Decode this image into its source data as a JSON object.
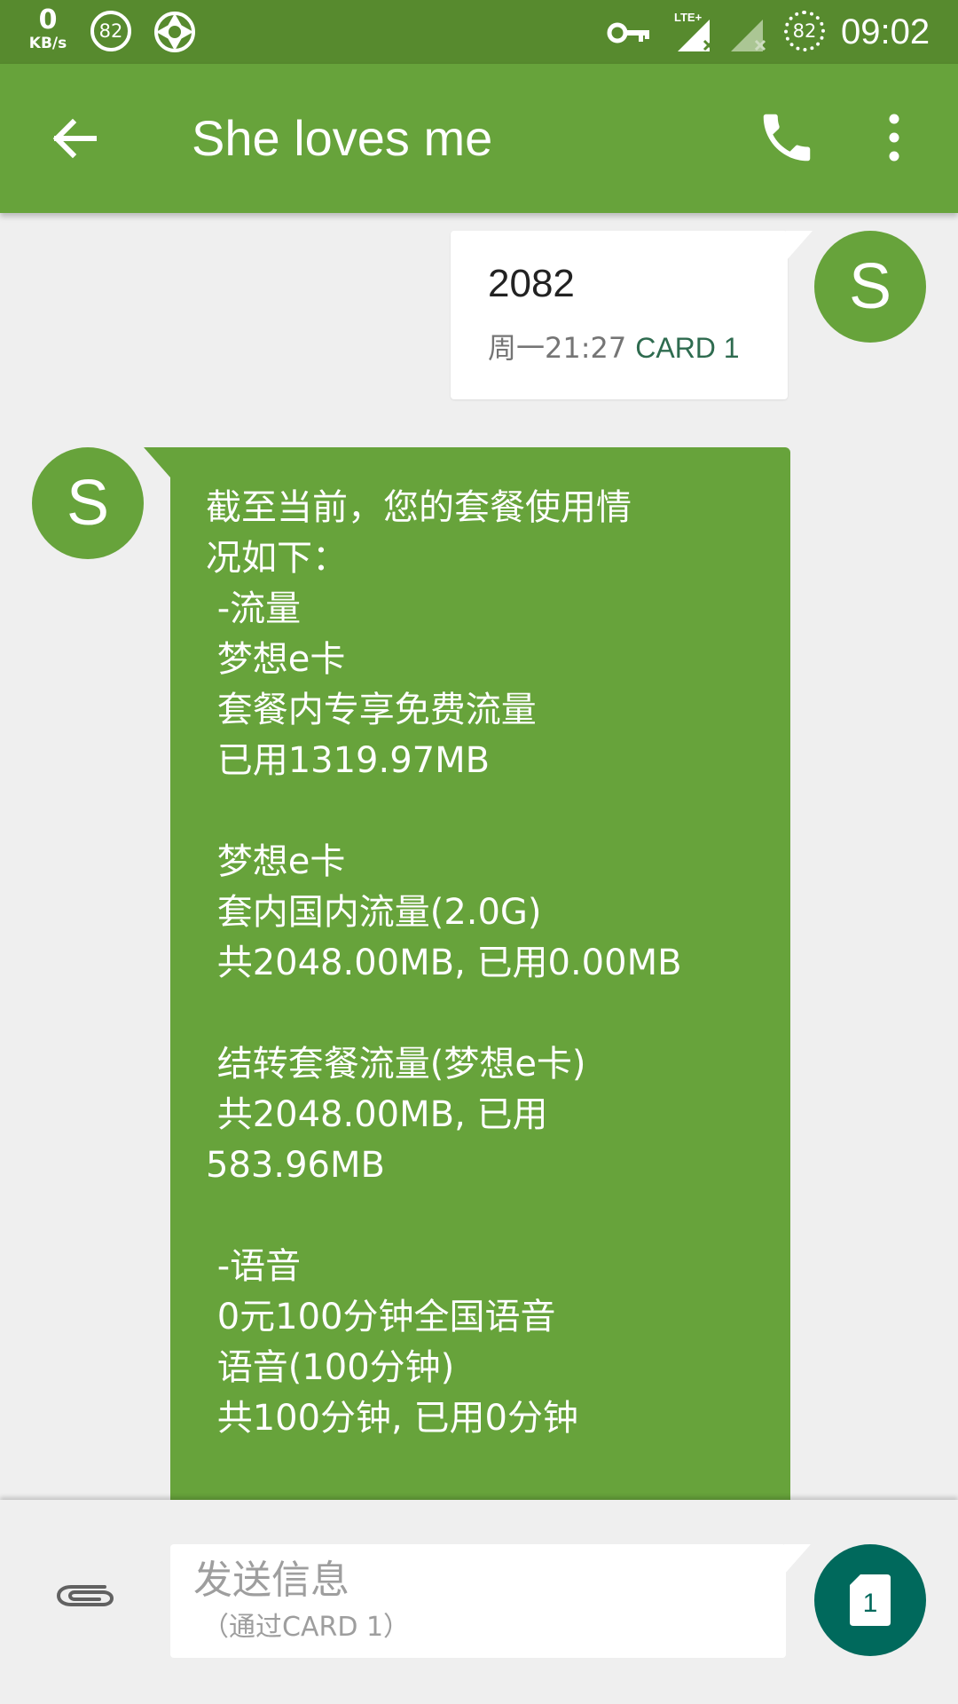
{
  "status_bar": {
    "net_speed": "0",
    "net_speed_unit": "KB/s",
    "left_badge": "82",
    "signal_type": "LTE+",
    "battery_level": "82",
    "time": "09:02",
    "icons": [
      "aperture-icon",
      "vpn-key-icon",
      "signal-lte-icon",
      "signal-no-service-icon",
      "battery-ring-icon"
    ]
  },
  "app_bar": {
    "title": "She loves me",
    "background": "#67a33b"
  },
  "conversation": {
    "outgoing": {
      "avatar_letter": "S",
      "text": "2082",
      "time": "周一21:27",
      "card": "CARD 1"
    },
    "incoming": {
      "avatar_letter": "S",
      "text": "截至当前，您的套餐使用情\n况如下：\n -流量\n 梦想e卡\n 套餐内专享免费流量\n 已用1319.97MB\n\n 梦想e卡\n 套内国内流量(2.0G)\n 共2048.00MB, 已用0.00MB\n\n 结转套餐流量(梦想e卡)\n 共2048.00MB, 已用\n583.96MB\n\n -语音\n 0元100分钟全国语音\n 语音(100分钟)\n 共100分钟, 已用0分钟",
      "bubble_color": "#67a33b"
    }
  },
  "compose": {
    "placeholder": "发送信息",
    "sub_hint": "（通过CARD 1）",
    "send_sim_number": "1",
    "send_color": "#00695c"
  }
}
